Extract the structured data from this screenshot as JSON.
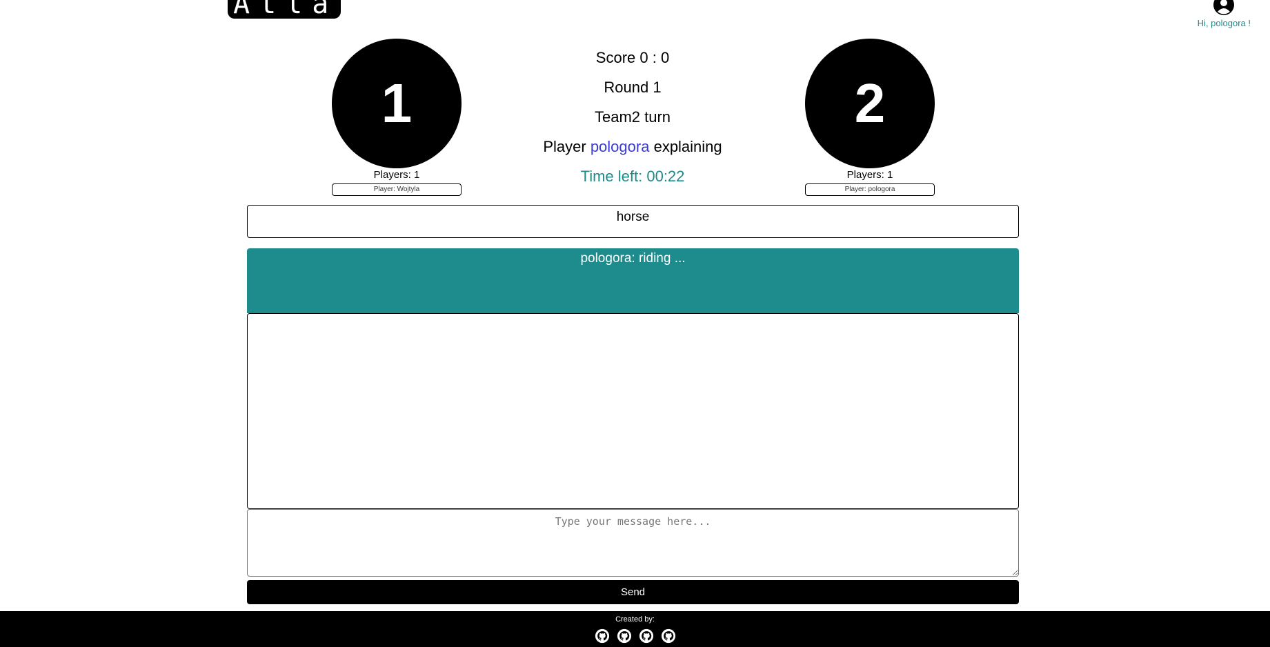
{
  "header": {
    "logo_text": "Atlas",
    "user_greeting": "Hi, pologora !",
    "user_icon": "user-avatar-icon"
  },
  "teams": [
    {
      "number": "1",
      "players_label": "Players: 1",
      "player_entry": "Player: Wojtyla"
    },
    {
      "number": "2",
      "players_label": "Players: 1",
      "player_entry": "Player: pologora"
    }
  ],
  "game": {
    "score": "Score 0 : 0",
    "round": "Round 1",
    "turn": "Team2 turn",
    "explaining_prefix": "Player",
    "explaining_player": "pologora",
    "explaining_suffix": "explaining",
    "time_left": "Time left: 00:22"
  },
  "word": "horse",
  "chat": {
    "messages": [
      {
        "text": "pologora: riding ..."
      }
    ],
    "input_placeholder": "Type your message here...",
    "send_label": "Send"
  },
  "footer": {
    "label": "Created by:",
    "links": [
      "github-icon",
      "github-icon",
      "github-icon",
      "github-icon"
    ]
  },
  "colors": {
    "accent_teal": "#1e8c8c",
    "player_highlight": "#3b3bd6",
    "primary": "#000000"
  }
}
